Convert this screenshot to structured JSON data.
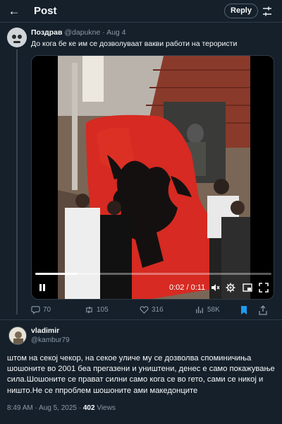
{
  "header": {
    "title": "Post",
    "reply_label": "Reply"
  },
  "quoted_tweet": {
    "display_name": "Поздрав",
    "handle": "@dapukne",
    "date": "Aug 4",
    "text": "До кога бе ке им се дозволуваат вакви работи на терористи",
    "video": {
      "time": "0:02 / 0:11",
      "progress": 0.18
    },
    "stats": {
      "replies": "70",
      "retweets": "105",
      "likes": "316",
      "views": "58K"
    }
  },
  "reply_tweet": {
    "display_name": "vladimir",
    "handle": "@kambur79",
    "text": "штом на секој чекор, на секое уличе му се дозволва споминичиња шошоните во 2001 беа прегазени и уништени, денес е само покажување сила.Шошоните се прават силни само кога се во гето, сами се никој и ништо.Не се ппроблем шошоните ами македонците",
    "time": "8:49 AM",
    "date": "Aug 5, 2025",
    "views_count": "402",
    "views_label": "Views"
  },
  "colors": {
    "background": "#15202b",
    "accent": "#1d9bf0",
    "muted": "#8b98a5",
    "flag_red": "#d62a22"
  }
}
